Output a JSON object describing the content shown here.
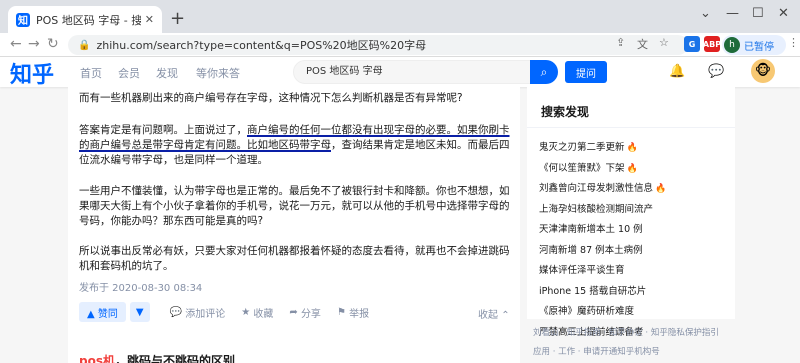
{
  "browser": {
    "tab_title": "POS 地区码 字母 - 搜索结果 - 知",
    "tab_favicon": "知",
    "url": "zhihu.com/search?type=content&q=POS%20地区码%20字母",
    "profile_initial": "h",
    "profile_label": "已暂停",
    "ext_abp": "ABP"
  },
  "header": {
    "logo": "知乎",
    "nav": [
      "首页",
      "会员",
      "发现",
      "等你来答"
    ],
    "search_value": "POS 地区码 字母",
    "ask_label": "提问"
  },
  "answer": {
    "p1": "而有一些机器刷出来的商户编号存在字母，这种情况下怎么判断机器是否有异常呢?",
    "p2": {
      "a": "答案肯定是有问题啊。上面说过了，",
      "b": "商户编号的任何一位都没有出现字母的必要。",
      "c": "如果你刷卡的商户编号总是带字母肯定有问题。",
      "d": "比如地区码带字母",
      "e": "，查询结果肯定是地区未知。而最后四位流水编号带字母，也是同样一个道理。"
    },
    "p3": "一些用户不懂装懂，认为带字母也是正常的。最后免不了被银行封卡和降额。你也不想想，如果哪天大街上有个小伙子拿着你的手机号，说花一万元，就可以从他的手机号中选择带字母的号码，你能办吗？那东西可能是真的吗?",
    "p4": "所以说事出反常必有妖，只要大家对任何机器都报着怀疑的态度去看待，就再也不会掉进跳码机和套码机的坑了。",
    "timestamp": "发布于 2020-08-30 08:34",
    "vote_label": "▲ 赞同",
    "comment": "添加评论",
    "favorite": "收藏",
    "share": "分享",
    "report": "举报",
    "collapse": "收起",
    "next_title_hl": "pos机",
    "next_title_rest": "，跳码与不跳码的区别"
  },
  "sidebar": {
    "title": "搜索发现",
    "trends": [
      {
        "text": "鬼灭之刃第二季更新",
        "hot": true
      },
      {
        "text": "《何以笙箫默》下架",
        "hot": true
      },
      {
        "text": "刘鑫曾向江母发刺激性信息",
        "hot": true
      },
      {
        "text": "上海孕妇核酸检测期间流产",
        "hot": false
      },
      {
        "text": "天津津南新增本土 10 例",
        "hot": false
      },
      {
        "text": "河南新增 87 例本土病例",
        "hot": false
      },
      {
        "text": "媒体评任泽平谈生育",
        "hot": false
      },
      {
        "text": "iPhone 15 搭载自研芯片",
        "hot": false
      },
      {
        "text": "《原神》魔药研析难度",
        "hot": false
      },
      {
        "text": "严禁高三上提前结课备考",
        "hot": false
      }
    ],
    "footer1": "刘看山 · 知乎指南 · 知乎协议 · 知乎隐私保护指引",
    "footer2": "应用 · 工作 · 申请开通知乎机构号"
  },
  "colors": {
    "brand": "#0066ff",
    "underline": "#0a1fa6",
    "hot": "#f1403c"
  }
}
